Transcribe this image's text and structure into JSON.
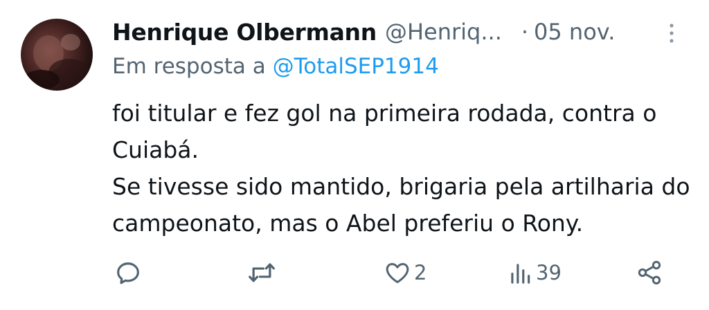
{
  "tweet": {
    "display_name": "Henrique Olbermann",
    "handle": "@Henriq...",
    "separator": "·",
    "date": "05 nov.",
    "reply_prefix": "Em resposta a ",
    "reply_to": "@TotalSEP1914",
    "text_paragraphs": [
      "foi titular e fez gol na primeira rodada, contra o Cuiabá.",
      "Se tivesse sido mantido, brigaria pela artilharia do campeonato, mas o Abel preferiu o Rony."
    ]
  },
  "actions": {
    "reply": {
      "icon": "reply-icon",
      "count": ""
    },
    "retweet": {
      "icon": "retweet-icon",
      "count": ""
    },
    "like": {
      "icon": "heart-icon",
      "count": "2"
    },
    "views": {
      "icon": "views-icon",
      "count": "39"
    },
    "share": {
      "icon": "share-icon",
      "count": ""
    }
  },
  "colors": {
    "text_primary": "#0f1419",
    "text_secondary": "#536471",
    "mention": "#1d9bf0",
    "background": "#ffffff"
  }
}
